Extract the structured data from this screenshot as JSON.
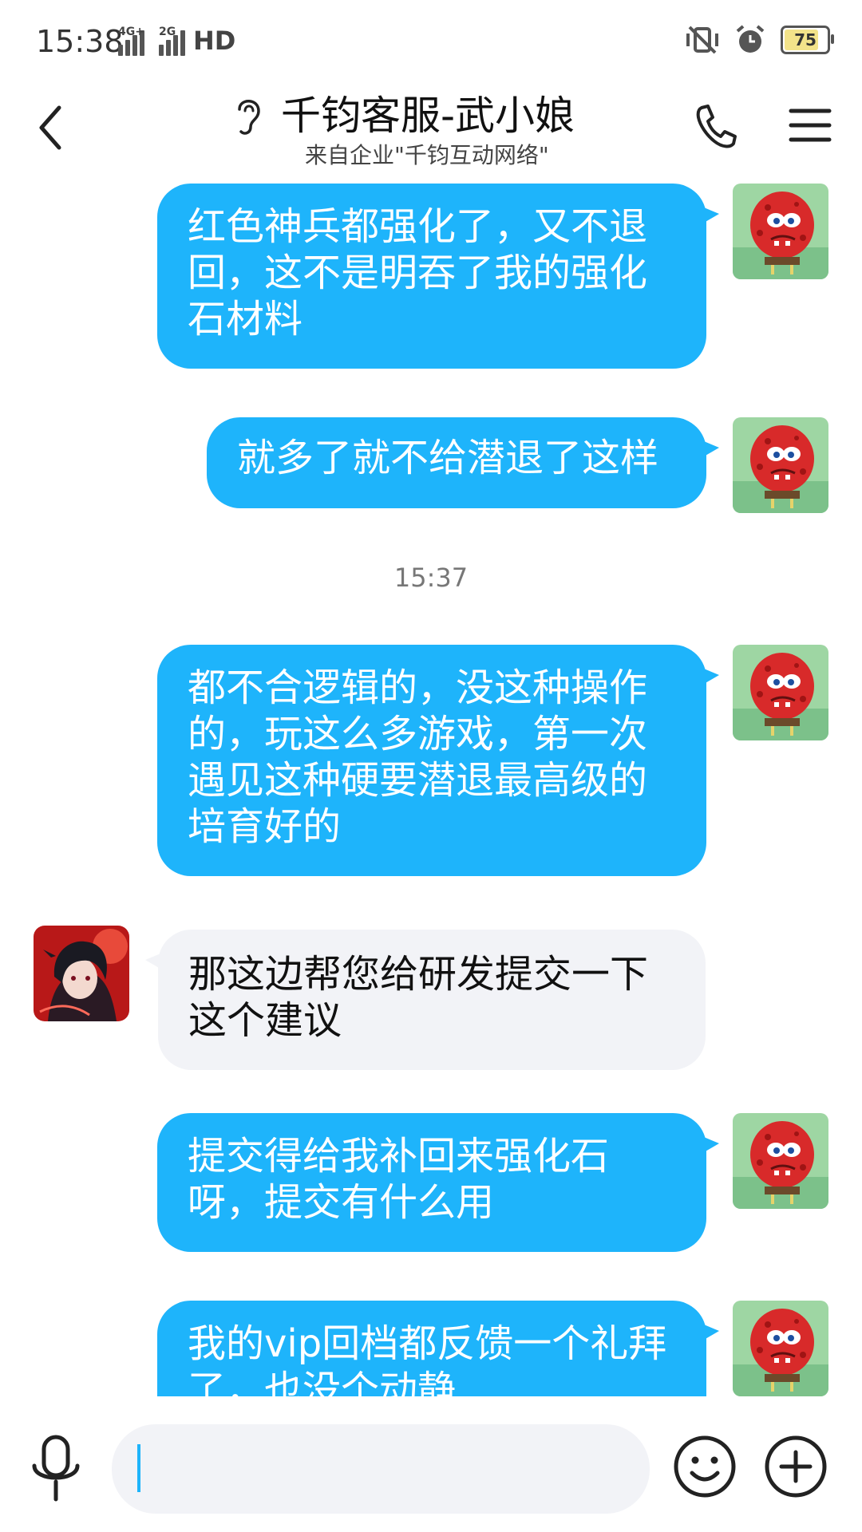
{
  "status_bar": {
    "time": "15:38",
    "net1_label": "4G+",
    "net2_label": "2G",
    "hd_label": "HD",
    "battery_level": "75",
    "icons": [
      "mute-vibrate-icon",
      "alarm-icon"
    ]
  },
  "header": {
    "title": "千钧客服-武小娘",
    "subtitle": "来自企业\"千钧互动网络\"",
    "icons": [
      "back-icon",
      "ear-icon",
      "phone-icon",
      "menu-icon"
    ]
  },
  "messages": [
    {
      "from": "self",
      "text": "红色神兵都强化了，又不退回，这不是明吞了我的强化石材料"
    },
    {
      "from": "self",
      "text": "就多了就不给潜退了这样"
    },
    {
      "type": "timestamp",
      "text": "15:37"
    },
    {
      "from": "self",
      "text": "都不合逻辑的，没这种操作的，玩这么多游戏，第一次遇见这种硬要潜退最高级的培育好的"
    },
    {
      "from": "agent",
      "text": "那这边帮您给研发提交一下这个建议"
    },
    {
      "from": "self",
      "text": "提交得给我补回来强化石呀，提交有什么用"
    },
    {
      "from": "self",
      "text": "我的vip回档都反馈一个礼拜了，也没个动静"
    }
  ],
  "input_bar": {
    "value": "",
    "icons": [
      "microphone-icon",
      "emoji-icon",
      "plus-icon"
    ]
  },
  "colors": {
    "outgoing_bubble": "#1eb4fb",
    "incoming_bubble": "#f2f3f7",
    "battery_fill": "#f3e38a"
  }
}
